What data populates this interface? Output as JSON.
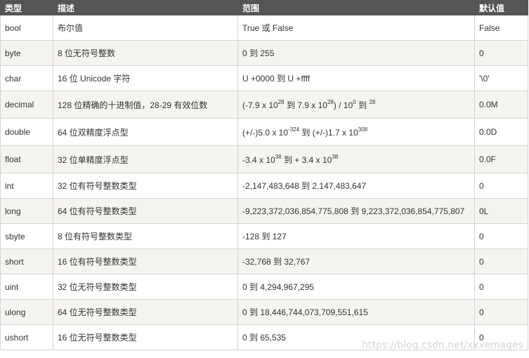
{
  "header": {
    "type": "类型",
    "desc": "描述",
    "range": "范围",
    "default": "默认值"
  },
  "rows": [
    {
      "type": "bool",
      "desc": "布尔值",
      "range": "True 或 False",
      "default": "False"
    },
    {
      "type": "byte",
      "desc": "8 位无符号整数",
      "range": "0 到 255",
      "default": "0"
    },
    {
      "type": "char",
      "desc": "16 位 Unicode 字符",
      "range": "U +0000 到 U +ffff",
      "default": "'\\0'"
    },
    {
      "type": "decimal",
      "desc": "128 位精确的十进制值，28-29 有效位数",
      "default": "0.0M",
      "range_parts": {
        "a": "(-7.9 x 10",
        "b": "28",
        "c": " 到 7.9 x 10",
        "d": "28",
        "e": ") / 10",
        "f": "0",
        "g": " 到 ",
        "h": "28"
      }
    },
    {
      "type": "double",
      "desc": "64 位双精度浮点型",
      "default": "0.0D",
      "range_parts": {
        "a": "(+/-)5.0 x 10",
        "b": "-324",
        "c": " 到 (+/-)1.7 x 10",
        "d": "308"
      }
    },
    {
      "type": "float",
      "desc": "32 位单精度浮点型",
      "default": "0.0F",
      "range_parts": {
        "a": "-3.4 x 10",
        "b": "38",
        "c": " 到 + 3.4 x 10",
        "d": "38"
      }
    },
    {
      "type": "int",
      "desc": "32 位有符号整数类型",
      "range": "-2,147,483,648 到 2,147,483,647",
      "default": "0"
    },
    {
      "type": "long",
      "desc": "64 位有符号整数类型",
      "range": "-9,223,372,036,854,775,808 到 9,223,372,036,854,775,807",
      "default": "0L"
    },
    {
      "type": "sbyte",
      "desc": "8 位有符号整数类型",
      "range": "-128 到 127",
      "default": "0"
    },
    {
      "type": "short",
      "desc": "16 位有符号整数类型",
      "range": "-32,768 到 32,767",
      "default": "0"
    },
    {
      "type": "uint",
      "desc": "32 位无符号整数类型",
      "range": "0 到 4,294,967,295",
      "default": "0"
    },
    {
      "type": "ulong",
      "desc": "64 位无符号整数类型",
      "range": "0 到 18,446,744,073,709,551,615",
      "default": "0"
    },
    {
      "type": "ushort",
      "desc": "16 位无符号整数类型",
      "range": "0 到 65,535",
      "default": "0"
    }
  ],
  "watermark": "https://blog.csdn.net/xxxemages"
}
